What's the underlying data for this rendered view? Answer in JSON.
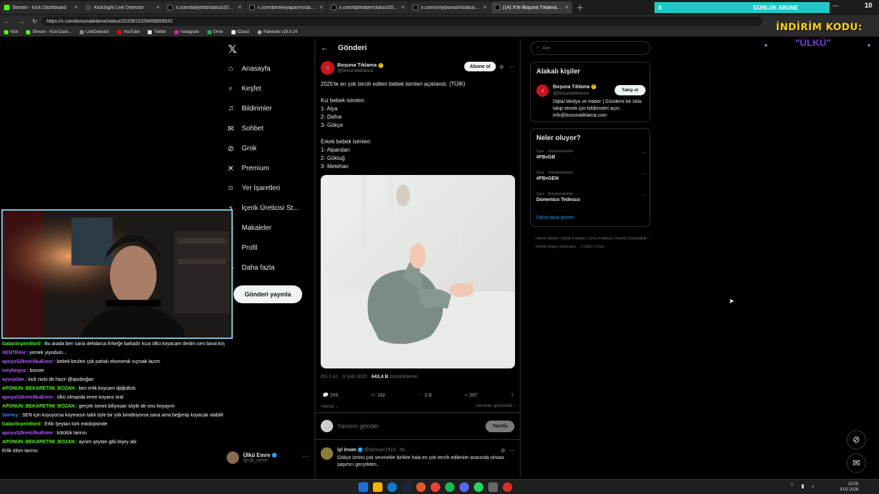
{
  "browser": {
    "tabs": [
      {
        "label": "Stream - Kick Dashboard",
        "icon": "kick-icon"
      },
      {
        "label": "KickSight Link Detector",
        "icon": "page-icon"
      },
      {
        "label": "x.com/dailytrkd/status/20199316...",
        "icon": "x-icon"
      },
      {
        "label": "x.com/benkeiyaparim/status/201...",
        "icon": "x-icon"
      },
      {
        "label": "x.com/bpthaber/status/20209434...",
        "icon": "x-icon"
      },
      {
        "label": "x.com/onlydramaX/status/20209...",
        "icon": "x-icon"
      },
      {
        "label": "(14) X'te Boşuna Tıklama: \"2025'te...",
        "icon": "x-icon",
        "active": true
      }
    ],
    "url": "https://x.com/bosunatiklama/status/2020810209459859542",
    "bookmarks": [
      "Kick",
      "Stream - Kick Dash...",
      "LinkDetector",
      "YouTube",
      "Twitter",
      "Instagram",
      "Drive",
      "iCloud",
      "Paletools v26.0.24"
    ]
  },
  "overlay": {
    "sub_goal_count": "8",
    "sub_goal_label": "GÜNLÜK ABONE",
    "sub_goal_target": "10",
    "promo_line1": "İNDİRİM KODU:",
    "promo_line2": "\"ÜLKÜ\""
  },
  "chat": [
    {
      "user": "Galacticprintlord",
      "color": "#53fc18",
      "text": "Bu arada ben sana defalarca Erkeğe bahadır kıza ülkü koyacam dedim sen bana koyma benim için koyacaksan koyma ben çok kafama takarım vs falan dedin @UlkuEmre"
    },
    {
      "user": "XENTRAH",
      "color": "#b25bff",
      "text": "yemek yiyodum..."
    },
    {
      "user": "apoyuS2kenUlkuEmre",
      "color": "#b25bff",
      "text": "bebek bezleri çok pahalı ekonomik sıçmak lazım"
    },
    {
      "user": "meybegus",
      "color": "#b25bff",
      "text": "bosver"
    },
    {
      "user": "aysupilan",
      "color": "#b25bff",
      "text": "kick nicki de hazır @apoboğan"
    },
    {
      "user": "APONUN_BEKARETINI_BOZAN",
      "color": "#53fc18",
      "text": "ben erlik koycam djdjkdlsls"
    },
    {
      "user": "apoyuS2kenUlkuEmre",
      "color": "#b25bff",
      "text": "ülkü olmazda emre koyarız kral"
    },
    {
      "user": "APONUN_BEKARETINI_BOZAN",
      "color": "#53fc18",
      "text": "gerçek ismini biliyosan söyle de onu koyayım"
    },
    {
      "user": "Sarney",
      "color": "#3b82f6",
      "text": "SEN için koyuyorsa koymasın tabii öyle bir yük binidiriyorsa sana ama beğenip koyacak olabilir"
    },
    {
      "user": "Galacticprintlord",
      "color": "#53fc18",
      "text": "Erlik Şeytan türk mitolojisinde"
    },
    {
      "user": "apoyuS2kenUlkuEmre",
      "color": "#b25bff",
      "text": "kötülük tanrısı"
    },
    {
      "user": "APONUN_BEKARETINI_BOZAN",
      "color": "#53fc18",
      "text": "aynen şeytan gibi bişey abi"
    },
    {
      "user": "",
      "color": "#ff4444",
      "text": "Erlik ölüm tanrısı"
    }
  ],
  "xnav": {
    "items": [
      {
        "label": "Anasayfa",
        "icon": "home-icon",
        "glyph": "⌂"
      },
      {
        "label": "Keşfet",
        "icon": "search-icon",
        "glyph": "⌕"
      },
      {
        "label": "Bildirimler",
        "icon": "bell-icon",
        "glyph": "♫"
      },
      {
        "label": "Sohbet",
        "icon": "chat-icon",
        "glyph": "✉"
      },
      {
        "label": "Grok",
        "icon": "grok-icon",
        "glyph": "⊘"
      },
      {
        "label": "Premium",
        "icon": "x-premium-icon",
        "glyph": "✕"
      },
      {
        "label": "Yer İşaretleri",
        "icon": "bookmark-icon",
        "glyph": "⌑"
      },
      {
        "label": "İçerik Üreticisi St...",
        "icon": "creator-studio-icon",
        "glyph": "⚡"
      },
      {
        "label": "Makaleler",
        "icon": "articles-icon",
        "glyph": "≣"
      },
      {
        "label": "Profil",
        "icon": "profile-icon",
        "glyph": "☺"
      },
      {
        "label": "Daha fazla",
        "icon": "more-icon",
        "glyph": "⋯"
      }
    ],
    "post_button": "Gönderi yayınla",
    "account_name": "Ülkü Emre",
    "account_handle": "@ulk_emre"
  },
  "post": {
    "header": "Gönderi",
    "author_name": "Boşuna Tıklama",
    "author_handle": "@bosunatiklama",
    "subscribe_button": "Abone ol",
    "text": "2025'te en çok tercih edilen bebek isimleri açıklandı. (TÜİK)\n\nKız bebek isimleri:\n1- Alya\n2- Defne\n3- Gökçe\n\nErkek bebek isimleri:\n1- Alparslan\n2- Göktuğ\n3- Metehan",
    "time": "ÖS 1:41 · 9 Şub 2026 ·",
    "views": "643,4 B",
    "views_label": "Görüntüleme",
    "replies": "205",
    "reposts": "162",
    "likes": "2 B",
    "bookmarks": "287",
    "relevant_label": "Alakalı",
    "quotes_label": "Alıntıları görüntüle",
    "reply_placeholder": "Yanıtını gönder",
    "reply_button": "Yanıtla"
  },
  "comment": {
    "name": "iyi insan",
    "handle": "@iyiinsan1919 · 8s",
    "text": "Gökçe ismini çok sevmekle birlikte hala en çok tercih edilenler arasında olması şaşırtıcı gerçekten.."
  },
  "sidebar": {
    "search_placeholder": "Ara",
    "related_title": "Alakalı kişiler",
    "related_name": "Boşuna Tıklama",
    "related_handle": "@bosunatiklama",
    "follow_button": "Takip et",
    "related_bio": "Dijital Medya ve Haber | Gündemi bir tıkla takip etmek için bildirimleri açın. info@bosunatiklama.com",
    "trends_title": "Neler oluyor?",
    "trends": [
      {
        "category": "Spor · Gündemdekiler",
        "name": "#FBvGB"
      },
      {
        "category": "Spor · Gündemdekiler",
        "name": "#FBvGEN"
      },
      {
        "category": "Spor · Gündemdekiler",
        "name": "Domenico Tedesco"
      }
    ],
    "show_more": "Daha fazla göster",
    "footer": "Hizmet Şartları  |  Gizlilik Politikası  |  Çerez Politikası  |  Imprint  |  Erişilebilirlik  |  Reklam bilgisi  |  Daha fazla ...  © 2026 X Corp."
  },
  "taskbar": {
    "time": "23:05",
    "date": "9.02.2026"
  }
}
